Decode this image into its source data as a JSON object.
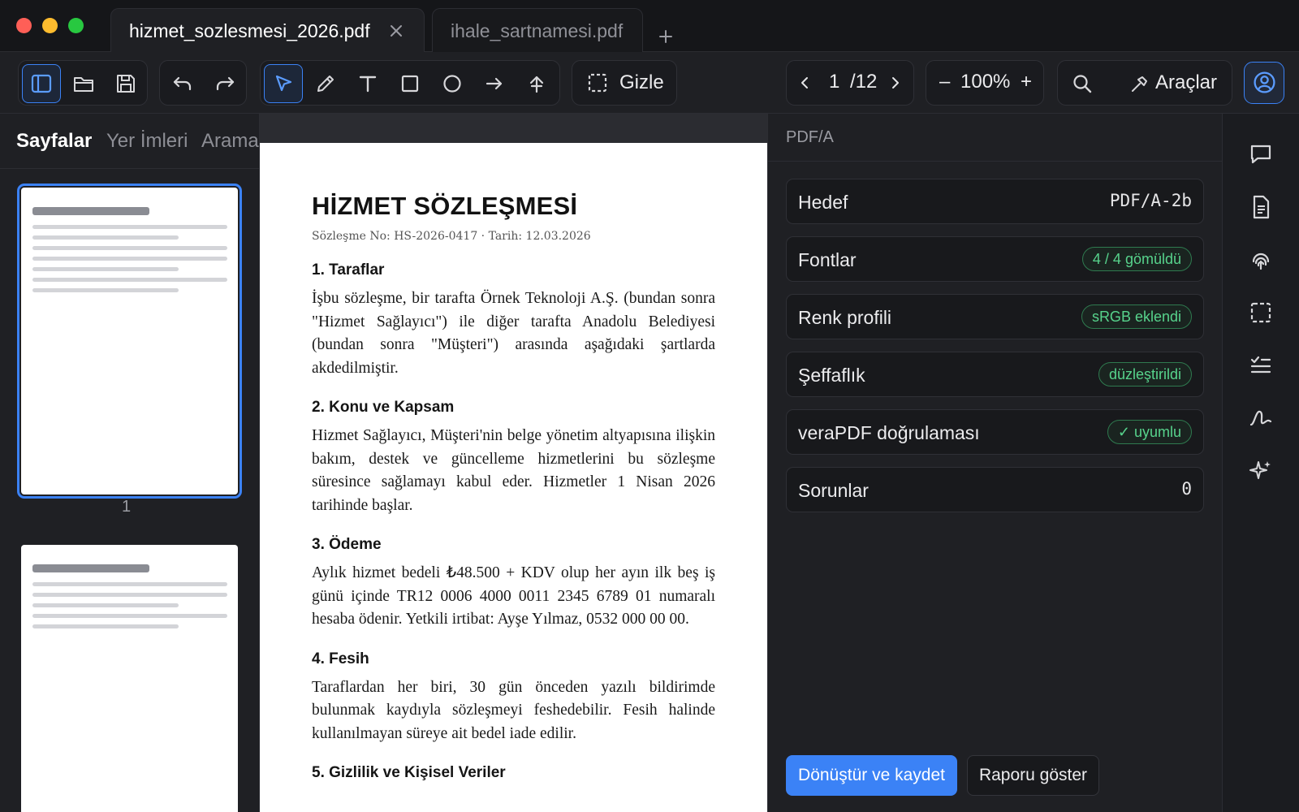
{
  "window": {
    "traffic_lights": [
      "#ff5f57",
      "#febc2e",
      "#28c840"
    ]
  },
  "tabs": [
    {
      "label": "hizmet_sozlesmesi_2026.pdf",
      "active": true
    },
    {
      "label": "ihale_sartnamesi.pdf",
      "active": false
    }
  ],
  "toolbar": {
    "hide_label": "Gizle",
    "page_current": "1",
    "page_total": "/12",
    "zoom_minus": "–",
    "zoom_value": "100%",
    "zoom_plus": "+",
    "tools_label": "Araçlar",
    "icons": [
      "sidebar-toggle-icon",
      "folder-open-icon",
      "save-icon",
      "undo-icon",
      "redo-icon",
      "select-cursor-icon",
      "pen-icon",
      "text-icon",
      "rectangle-icon",
      "ellipse-icon",
      "arrow-icon",
      "upload-arrow-icon",
      "selection-icon",
      "search-icon",
      "hammer-icon",
      "user-icon"
    ]
  },
  "sidebar": {
    "tabs": [
      "Sayfalar",
      "Yer İmleri",
      "Arama"
    ],
    "thumb_numbers": [
      "1"
    ]
  },
  "document": {
    "title": "HİZMET SÖZLEŞMESİ",
    "meta": "Sözleşme No: HS-2026-0417 · Tarih: 12.03.2026",
    "sections": [
      {
        "heading": "1. Taraflar",
        "body": "İşbu sözleşme, bir tarafta Örnek Teknoloji A.Ş. (bundan sonra \"Hizmet Sağlayıcı\") ile diğer tarafta Anadolu Belediyesi (bundan sonra \"Müşteri\") arasında aşağıdaki şartlarda akdedilmiştir."
      },
      {
        "heading": "2. Konu ve Kapsam",
        "body": "Hizmet Sağlayıcı, Müşteri'nin belge yönetim altyapısına ilişkin bakım, destek ve güncelleme hizmetlerini bu sözleşme süresince sağlamayı kabul eder. Hizmetler 1 Nisan 2026 tarihinde başlar."
      },
      {
        "heading": "3. Ödeme",
        "body": "Aylık hizmet bedeli ₺48.500 + KDV olup her ayın ilk beş iş günü içinde TR12 0006 4000 0011 2345 6789 01 numaralı hesaba ödenir. Yetkili irtibat: Ayşe Yılmaz, 0532 000 00 00."
      },
      {
        "heading": "4. Fesih",
        "body": "Taraflardan her biri, 30 gün önceden yazılı bildirimde bulunmak kaydıyla sözleşmeyi feshedebilir. Fesih halinde kullanılmayan süreye ait bedel iade edilir."
      },
      {
        "heading": "5. Gizlilik ve Kişisel Veriler",
        "body": ""
      }
    ]
  },
  "panel": {
    "title": "PDF/A",
    "rows": [
      {
        "label": "Hedef",
        "value": "PDF/A-2b",
        "kind": "mono"
      },
      {
        "label": "Fontlar",
        "value": "4 / 4 gömüldü",
        "kind": "pill"
      },
      {
        "label": "Renk profili",
        "value": "sRGB eklendi",
        "kind": "pill"
      },
      {
        "label": "Şeffaflık",
        "value": "düzleştirildi",
        "kind": "pill"
      },
      {
        "label": "veraPDF doğrulaması",
        "value": "✓ uyumlu",
        "kind": "pill"
      },
      {
        "label": "Sorunlar",
        "value": "0",
        "kind": "mono"
      }
    ],
    "primary_button": "Dönüştür ve kaydet",
    "secondary_button": "Raporu göster",
    "accent": "#3b82f6",
    "success": "#57d38c"
  },
  "rail": {
    "icons": [
      "comment-icon",
      "document-icon",
      "fingerprint-icon",
      "selection-icon",
      "checklist-icon",
      "signature-icon",
      "sparkles-icon"
    ]
  }
}
